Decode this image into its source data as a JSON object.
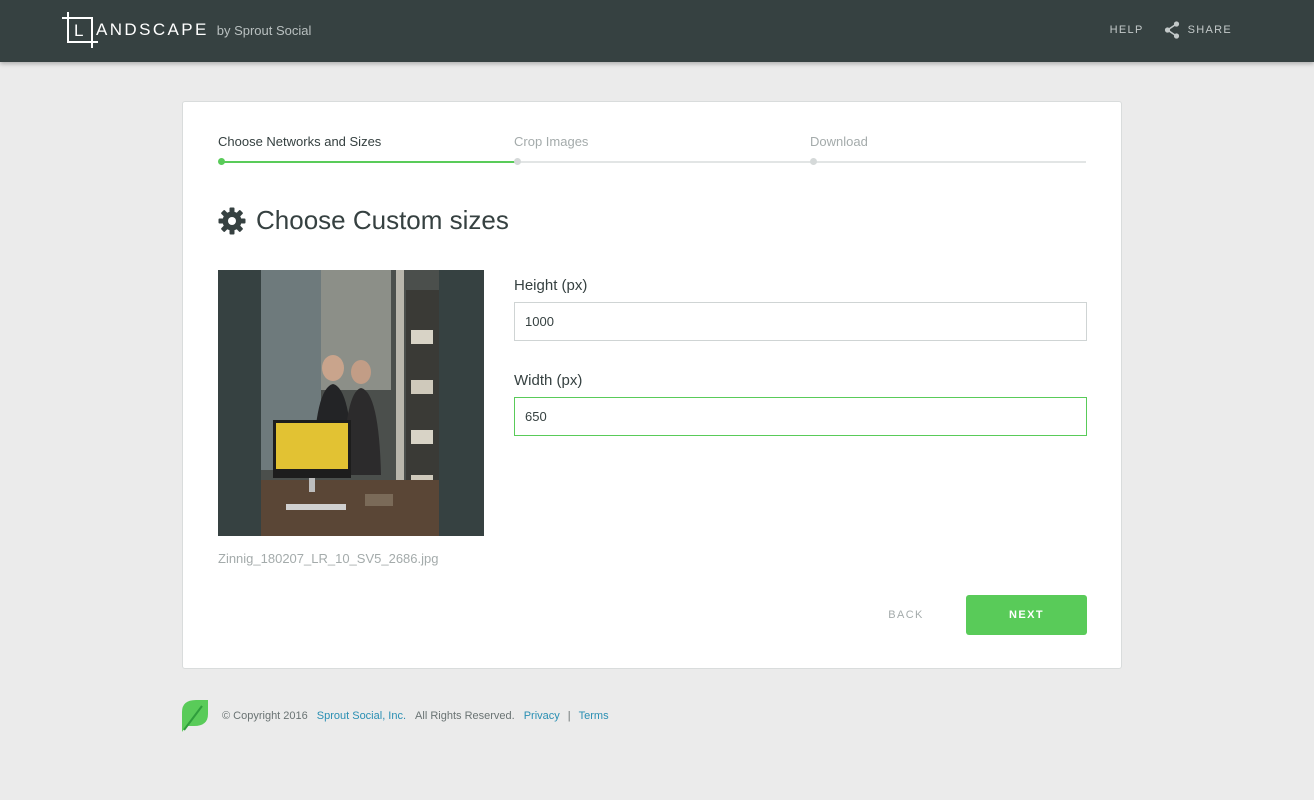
{
  "header": {
    "logo_text": "ANDSCAPE",
    "logo_letter": "L",
    "logo_by": "by Sprout Social",
    "nav": {
      "help": "HELP",
      "share": "SHARE"
    }
  },
  "steps": [
    {
      "label": "Choose Networks and Sizes",
      "active": true
    },
    {
      "label": "Crop Images",
      "active": false
    },
    {
      "label": "Download",
      "active": false
    }
  ],
  "section": {
    "title": "Choose Custom sizes",
    "icon": "gear-icon"
  },
  "image": {
    "filename": "Zinnig_180207_LR_10_SV5_2686.jpg"
  },
  "form": {
    "height_label": "Height (px)",
    "height_value": "1000",
    "width_label": "Width (px)",
    "width_value": "650"
  },
  "buttons": {
    "back": "BACK",
    "next": "NEXT"
  },
  "footer": {
    "copyright": "© Copyright 2016",
    "company": "Sprout Social, Inc.",
    "rights": "All Rights Reserved.",
    "privacy": "Privacy",
    "separator": "|",
    "terms": "Terms"
  },
  "colors": {
    "header_bg": "#364141",
    "accent_green": "#59cb59",
    "link_blue": "#2a8fb3",
    "page_bg": "#ebebeb"
  }
}
